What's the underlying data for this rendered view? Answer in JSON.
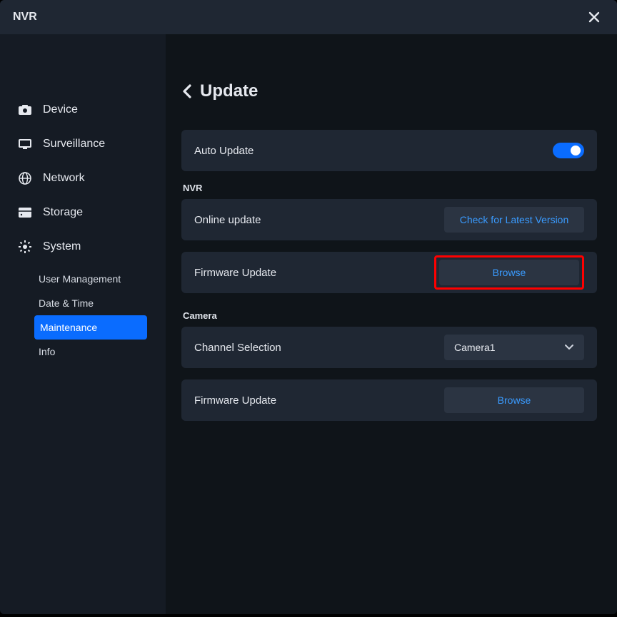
{
  "titlebar": {
    "title": "NVR"
  },
  "sidebar": {
    "items": [
      {
        "label": "Device"
      },
      {
        "label": "Surveillance"
      },
      {
        "label": "Network"
      },
      {
        "label": "Storage"
      },
      {
        "label": "System"
      }
    ],
    "system_sub": [
      {
        "label": "User Management"
      },
      {
        "label": "Date & Time"
      },
      {
        "label": "Maintenance"
      },
      {
        "label": "Info"
      }
    ]
  },
  "page": {
    "title": "Update",
    "auto_update_label": "Auto Update",
    "section_nvr": "NVR",
    "section_camera": "Camera",
    "online_update_label": "Online update",
    "check_version_btn": "Check for Latest Version",
    "firmware_update_label": "Firmware Update",
    "browse_btn": "Browse",
    "channel_selection_label": "Channel Selection",
    "channel_value": "Camera1"
  }
}
